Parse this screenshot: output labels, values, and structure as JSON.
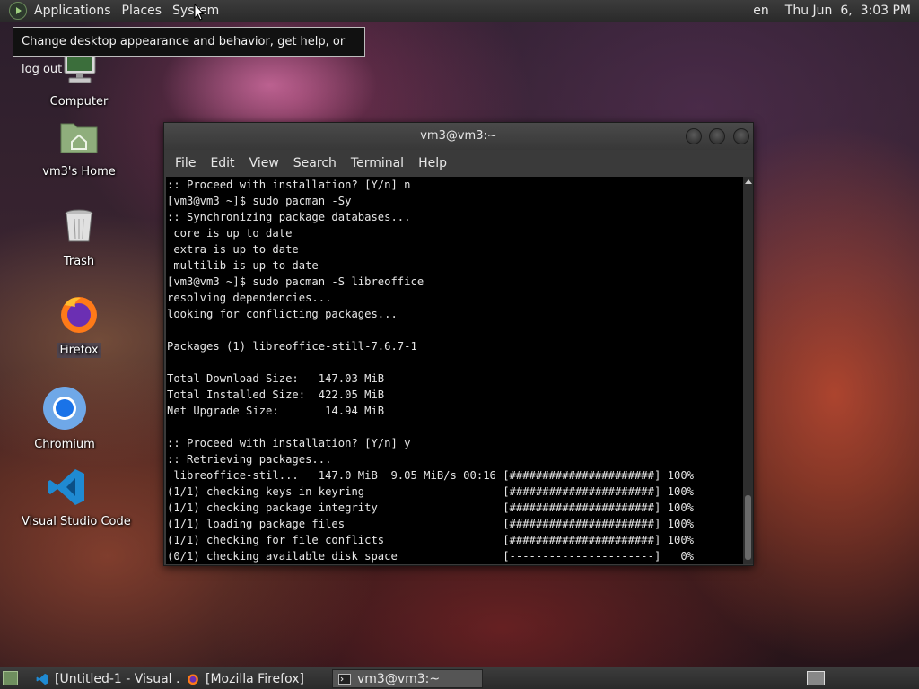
{
  "top_panel": {
    "menus": [
      "Applications",
      "Places",
      "System"
    ],
    "keyboard_layout": "en",
    "clock": "Thu Jun  6,  3:03 PM"
  },
  "tooltip": {
    "text": "Change desktop appearance and behavior, get help, or log out"
  },
  "desktop_icons": [
    {
      "label": "Computer",
      "icon": "computer-icon"
    },
    {
      "label": "vm3's Home",
      "icon": "home-folder-icon"
    },
    {
      "label": "Trash",
      "icon": "trash-icon"
    },
    {
      "label": "Firefox",
      "icon": "firefox-icon"
    },
    {
      "label": "Chromium",
      "icon": "chromium-icon"
    },
    {
      "label": "Visual Studio Code",
      "icon": "vscode-icon"
    }
  ],
  "terminal": {
    "title": "vm3@vm3:~",
    "menus": [
      "File",
      "Edit",
      "View",
      "Search",
      "Terminal",
      "Help"
    ],
    "lines": [
      ":: Proceed with installation? [Y/n] n",
      "[vm3@vm3 ~]$ sudo pacman -Sy",
      ":: Synchronizing package databases...",
      " core is up to date",
      " extra is up to date",
      " multilib is up to date",
      "[vm3@vm3 ~]$ sudo pacman -S libreoffice",
      "resolving dependencies...",
      "looking for conflicting packages...",
      "",
      "Packages (1) libreoffice-still-7.6.7-1",
      "",
      "Total Download Size:   147.03 MiB",
      "Total Installed Size:  422.05 MiB",
      "Net Upgrade Size:       14.94 MiB",
      "",
      ":: Proceed with installation? [Y/n] y",
      ":: Retrieving packages...",
      " libreoffice-stil...   147.0 MiB  9.05 MiB/s 00:16 [######################] 100%",
      "(1/1) checking keys in keyring                     [######################] 100%",
      "(1/1) checking package integrity                   [######################] 100%",
      "(1/1) loading package files                        [######################] 100%",
      "(1/1) checking for file conflicts                  [######################] 100%",
      "(0/1) checking available disk space                [----------------------]   0%"
    ]
  },
  "taskbar": {
    "tasks": [
      {
        "label": "[Untitled-1 - Visual ...",
        "icon": "vscode-icon",
        "active": false
      },
      {
        "label": "[Mozilla Firefox]",
        "icon": "firefox-icon",
        "active": false
      },
      {
        "label": "vm3@vm3:~",
        "icon": "terminal-icon",
        "active": true
      }
    ]
  },
  "colors": {
    "terminal_bg": "#000000",
    "terminal_fg": "#e6e6e6",
    "panel_bg": "#333333"
  }
}
